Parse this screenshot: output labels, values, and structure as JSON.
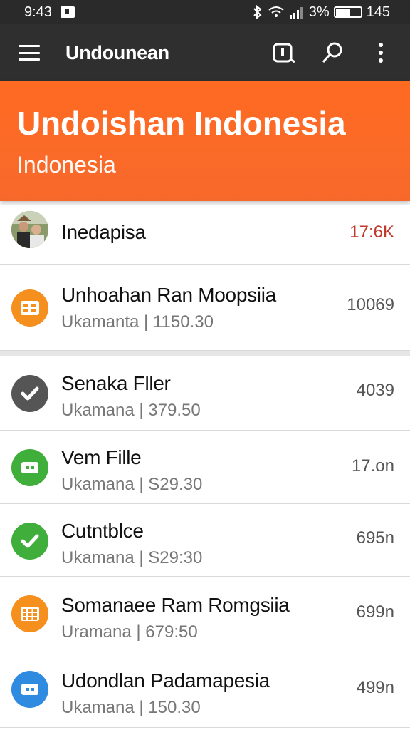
{
  "status": {
    "time": "9:43",
    "battery_text": "3%",
    "right_number": "145"
  },
  "app_bar": {
    "title": "Undounean"
  },
  "hero": {
    "title": "Undoishan Indonesia",
    "subtitle": "Indonesia"
  },
  "rows": [
    {
      "title": "Inedapisa",
      "value": "17:6K",
      "value_color": "#c0392b"
    },
    {
      "title": "Unhoahan Ran Moopsiia",
      "subtitle": "Ukamanta | 1150.30",
      "value": "10069",
      "icon": "grid-icon",
      "icon_color": "#f5901e"
    },
    {
      "title": "Senaka Fller",
      "subtitle": "Ukamana | 379.50",
      "value": "4039",
      "icon": "check-icon",
      "icon_color": "#555555"
    },
    {
      "title": "Vem Fille",
      "subtitle": "Ukamana | S29.30",
      "value": "17.on",
      "icon": "card-icon",
      "icon_color": "#3fae3a"
    },
    {
      "title": "Cutntblce",
      "subtitle": "Ukamana | S29:30",
      "value": "695n",
      "icon": "check-icon",
      "icon_color": "#3fae3a"
    },
    {
      "title": "Somanaee Ram Romgsiia",
      "subtitle": "Uramana | 679:50",
      "value": "699n",
      "icon": "grid-icon",
      "icon_color": "#f5901e"
    },
    {
      "title": "Udondlan Padamapesia",
      "subtitle": "Ukamana | 150.30",
      "value": "499n",
      "icon": "card-icon",
      "icon_color": "#2f8be0"
    }
  ]
}
